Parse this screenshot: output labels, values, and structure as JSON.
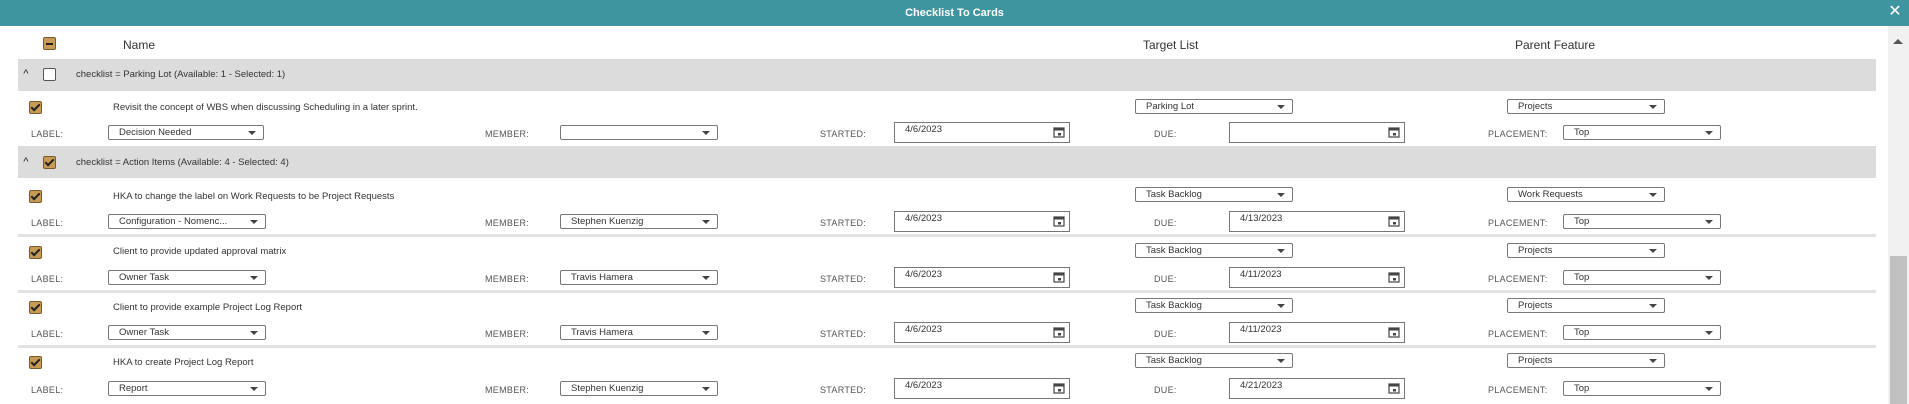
{
  "window": {
    "title": "Checklist To Cards",
    "close_glyph": "✕"
  },
  "header": {
    "name": "Name",
    "target_list": "Target List",
    "parent_feature": "Parent Feature",
    "select_all_state": "indeterminate"
  },
  "field_labels": {
    "label": "LABEL:",
    "member": "MEMBER:",
    "started": "STARTED:",
    "due": "DUE:",
    "placement": "PLACEMENT:"
  },
  "groups": [
    {
      "title": "checklist = Parking Lot (Available: 1 - Selected: 1)",
      "checked": false,
      "expanded": true,
      "items": [
        {
          "text": "Revisit the concept of WBS when discussing Scheduling in a later sprint.",
          "checked": true,
          "target_list": "Parking Lot",
          "parent_feature": "Projects",
          "label": "Decision Needed",
          "member": "",
          "started": "4/6/2023",
          "due": "",
          "placement": "Top"
        }
      ]
    },
    {
      "title": "checklist = Action Items (Available: 4 - Selected: 4)",
      "checked": true,
      "expanded": true,
      "items": [
        {
          "text": "HKA to change the label on Work Requests to be Project Requests",
          "checked": true,
          "target_list": "Task Backlog",
          "parent_feature": "Work Requests",
          "label": "Configuration - Nomenc...",
          "member": "Stephen Kuenzig",
          "started": "4/6/2023",
          "due": "4/13/2023",
          "placement": "Top"
        },
        {
          "text": "Client to provide updated approval matrix",
          "checked": true,
          "target_list": "Task Backlog",
          "parent_feature": "Projects",
          "label": "Owner Task",
          "member": "Travis Hamera",
          "started": "4/6/2023",
          "due": "4/11/2023",
          "placement": "Top"
        },
        {
          "text": "Client to provide example Project Log Report",
          "checked": true,
          "target_list": "Task Backlog",
          "parent_feature": "Projects",
          "label": "Owner Task",
          "member": "Travis Hamera",
          "started": "4/6/2023",
          "due": "4/11/2023",
          "placement": "Top"
        },
        {
          "text": "HKA to create Project Log Report",
          "checked": true,
          "target_list": "Task Backlog",
          "parent_feature": "Projects",
          "label": "Report",
          "member": "Stephen Kuenzig",
          "started": "4/6/2023",
          "due": "4/21/2023",
          "placement": "Top"
        }
      ]
    }
  ],
  "colors": {
    "titlebar": "#3f959f",
    "group_row": "#dcdcdc",
    "checkbox_checked": "#c89a57"
  }
}
